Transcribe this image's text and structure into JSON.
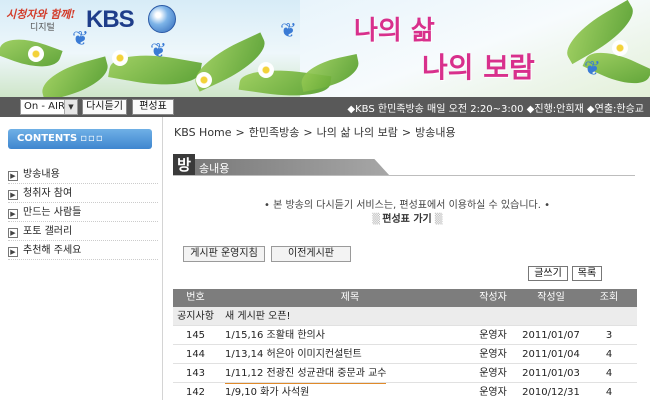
{
  "banner": {
    "slogan": "시청자와 함께!",
    "digital": "디지털",
    "logo": "KBS",
    "title_line1": "나의 삶",
    "title_line2": "나의 보람"
  },
  "nav": {
    "select_value": "On - AIR",
    "listen_again": "다시듣기",
    "schedule": "편성표",
    "info": "◆KBS 한민족방송 매일 오전 2:20~3:00 ◆진행:안희재 ◆연출:한승교"
  },
  "sidebar": {
    "heading": "CONTENTS",
    "heading_dots": "▫▫▫",
    "items": [
      {
        "label": "방송내용"
      },
      {
        "label": "청취자 참여"
      },
      {
        "label": "만드는 사람들"
      },
      {
        "label": "포토 갤러리"
      },
      {
        "label": "추천해 주세요"
      }
    ]
  },
  "breadcrumb": [
    "KBS Home",
    "한민족방송",
    "나의 삶 나의 보람",
    "방송내용"
  ],
  "section": {
    "first_char": "방",
    "rest": "송내용"
  },
  "notice": {
    "line1": "• 본 방송의 다시듣기 서비스는, 편성표에서 이용하실 수 있습니다. •",
    "link_deco_left": "▒",
    "link": "편성표 가기",
    "link_deco_right": "▒"
  },
  "buttons": {
    "board_rules": "게시판 운영지침",
    "old_board": "이전게시판",
    "write": "글쓰기",
    "list": "목록"
  },
  "table": {
    "headers": {
      "no": "번호",
      "title": "제목",
      "author": "작성자",
      "date": "작성일",
      "views": "조회"
    },
    "notice_row": {
      "no": "공지사항",
      "title": "새 게시판 오픈!"
    },
    "rows": [
      {
        "no": "145",
        "title": "1/15,16 조활태 한의사",
        "author": "운영자",
        "date": "2011/01/07",
        "views": "3"
      },
      {
        "no": "144",
        "title": "1/13,14 허은아 이미지컨설턴트",
        "author": "운영자",
        "date": "2011/01/04",
        "views": "4"
      },
      {
        "no": "143",
        "title": "1/11,12 전광진 성균관대 중문과 교수",
        "author": "운영자",
        "date": "2011/01/03",
        "views": "4"
      },
      {
        "no": "142",
        "title": "1/9,10 화가 사석원",
        "author": "운영자",
        "date": "2010/12/31",
        "views": "4"
      }
    ]
  }
}
